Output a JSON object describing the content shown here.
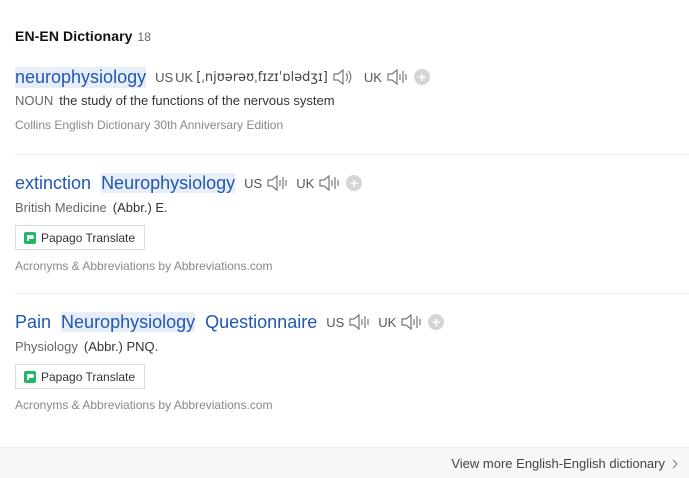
{
  "section": {
    "title": "EN-EN Dictionary",
    "count": "18"
  },
  "entries": [
    {
      "headword_parts": [
        "neurophysiology"
      ],
      "us_label": "US",
      "uk_label": "UK",
      "uk_label2": "UK",
      "ipa": "[ˌnjʊərəʊˌfɪzɪˈɒlədʒɪ]",
      "pos": "NOUN",
      "definition": "the study of the functions of the nervous system",
      "source": "Collins English Dictionary 30th Anniversary Edition"
    },
    {
      "headword_parts": [
        "extinction",
        "Neurophysiology"
      ],
      "us_label": "US",
      "uk_label": "UK",
      "pos": "British Medicine",
      "definition": "(Abbr.) E.",
      "translate_label": "Papago Translate",
      "source": "Acronyms & Abbreviations by Abbreviations.com"
    },
    {
      "headword_parts": [
        "Pain",
        "Neurophysiology",
        "Questionnaire"
      ],
      "us_label": "US",
      "uk_label": "UK",
      "pos": "Physiology",
      "definition": "(Abbr.) PNQ.",
      "translate_label": "Papago Translate",
      "source": "Acronyms & Abbreviations by Abbreviations.com"
    }
  ],
  "footer": {
    "more_label": "View more English-English dictionary"
  },
  "icons": {
    "speaker": "speaker-icon",
    "add": "plus-icon",
    "papago": "papago-icon",
    "chevron": "chevron-right-icon"
  },
  "colors": {
    "headword": "#1f58b3",
    "highlight": "#e8eef9"
  }
}
